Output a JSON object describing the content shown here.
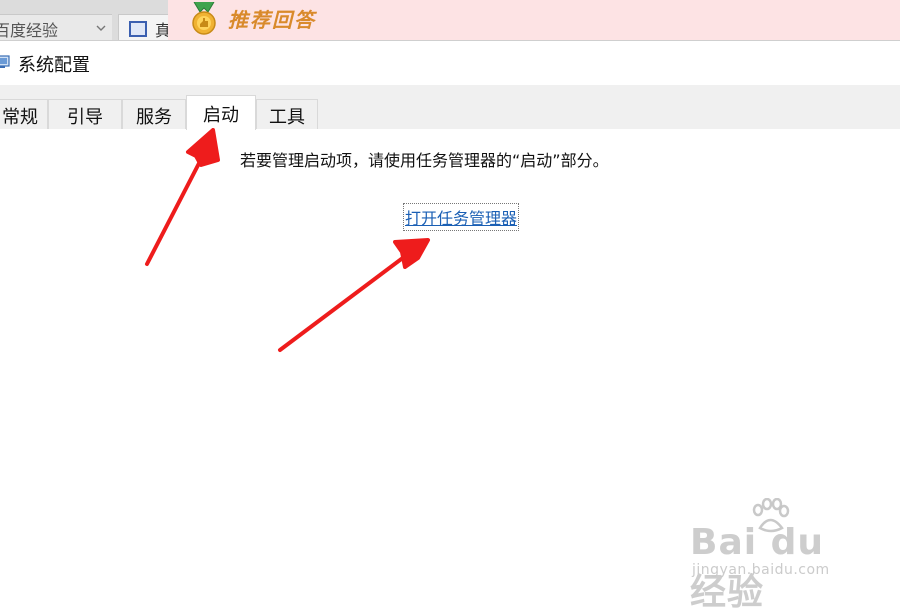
{
  "browser": {
    "left_tab_text": "百度经验",
    "right_tab_text": "真"
  },
  "banner": {
    "text": "推荐回答"
  },
  "window": {
    "title": "系统配置"
  },
  "tabs": [
    {
      "label": "常规",
      "active": false
    },
    {
      "label": "引导",
      "active": false
    },
    {
      "label": "服务",
      "active": false
    },
    {
      "label": "启动",
      "active": true
    },
    {
      "label": "工具",
      "active": false
    }
  ],
  "content": {
    "message": "若要管理启动项，请使用任务管理器的“启动”部分。",
    "link": "打开任务管理器"
  },
  "watermark": {
    "brand": "Bai du 经验",
    "url": "jingyan.baidu.com"
  },
  "colors": {
    "annotation_arrow": "#ee1c1c",
    "link": "#1a5fb4",
    "banner_bg": "#fde3e4",
    "tab_bar_bg": "#f0f0f0"
  }
}
